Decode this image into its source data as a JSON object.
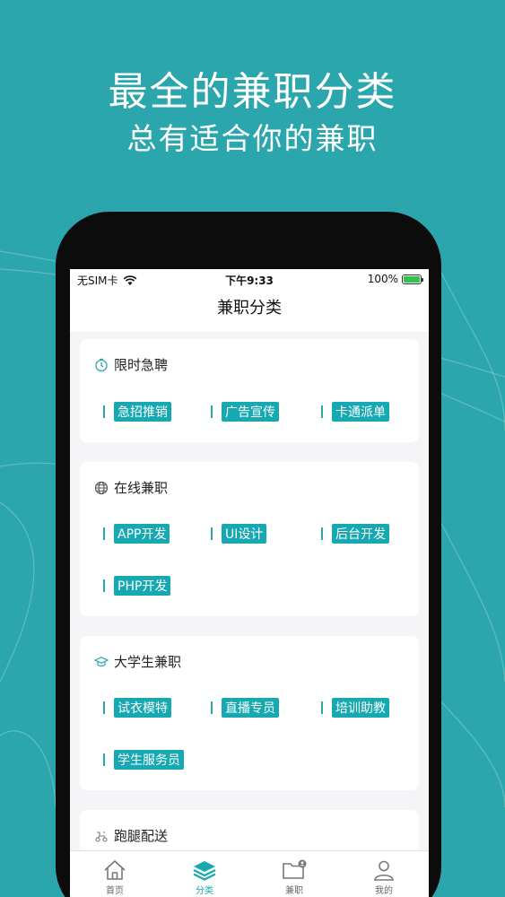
{
  "headline": {
    "line1": "最全的兼职分类",
    "line2": "总有适合你的兼职"
  },
  "status_bar": {
    "carrier": "无SIM卡",
    "time": "下午9:33",
    "battery": "100%"
  },
  "nav": {
    "title": "兼职分类"
  },
  "categories": [
    {
      "title": "限时急聘",
      "icon": "timer-icon",
      "tags": [
        "急招推销",
        "广告宣传",
        "卡通派单"
      ]
    },
    {
      "title": "在线兼职",
      "icon": "globe-icon",
      "tags": [
        "APP开发",
        "UI设计",
        "后台开发",
        "PHP开发"
      ]
    },
    {
      "title": "大学生兼职",
      "icon": "graduation-cap-icon",
      "tags": [
        "试衣模特",
        "直播专员",
        "培训助教",
        "学生服务员"
      ]
    },
    {
      "title": "跑腿配送",
      "icon": "scooter-icon",
      "tags": []
    }
  ],
  "tab_bar": [
    {
      "label": "首页",
      "icon": "home-icon"
    },
    {
      "label": "分类",
      "icon": "layers-icon",
      "active": true
    },
    {
      "label": "兼职",
      "icon": "folder-user-icon"
    },
    {
      "label": "我的",
      "icon": "user-icon"
    }
  ],
  "colors": {
    "background": "#2ba6ad",
    "accent": "#17a9b2",
    "screen_bg": "#f5f5f7"
  }
}
